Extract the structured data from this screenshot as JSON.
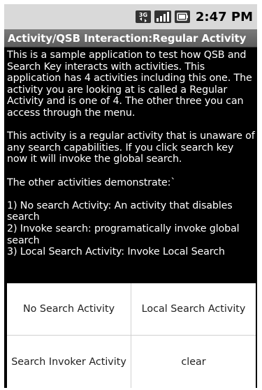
{
  "status_bar": {
    "time": "2:47 PM",
    "icons": [
      "3g-data-icon",
      "signal-strength-icon",
      "battery-icon"
    ]
  },
  "title_bar": {
    "title": "Activity/QSB Interaction:Regular Activity"
  },
  "content": {
    "paragraph1": "This is a sample application to test how QSB and Search Key interacts with activities. This application has 4 activities including this one. The activity you are looking at is called a Regular Activity and is one of 4. The other three you can access through the menu.",
    "paragraph2": " This activity is a regular activity that is unaware of any search capabilities. If you click search key now it will invoke the global search.",
    "paragraph3": "The other activities demonstrate:`",
    "list": [
      "1) No search Activity: An activity that disables search",
      "2) Invoke search: programatically invoke global search",
      "3) Local Search Activity: Invoke Local Search"
    ]
  },
  "menu": {
    "buttons": [
      "No Search Activity",
      "Local Search Activity",
      "Search Invoker Activity",
      "clear"
    ]
  },
  "colors": {
    "background": "#000000",
    "status_bar": "#d9d9d9",
    "title_bar": "#6a6a6a",
    "menu_background": "#ffffff"
  }
}
